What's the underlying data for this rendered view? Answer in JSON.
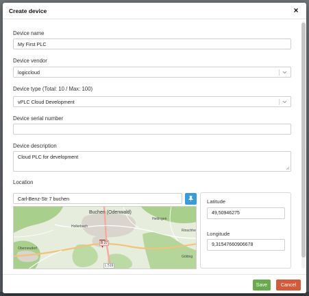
{
  "modal": {
    "title": "Create device",
    "close_glyph": "×"
  },
  "fields": {
    "device_name": {
      "label": "Device name",
      "value": "My First PLC"
    },
    "device_vendor": {
      "label": "Device vendor",
      "value": "logiccloud"
    },
    "device_type": {
      "label": "Device type (Total: 10 / Max: 100)",
      "value": "vPLC Cloud Development"
    },
    "serial_number": {
      "label": "Device serial number",
      "value": ""
    },
    "description": {
      "label": "Device description",
      "value": "Cloud PLC for development"
    }
  },
  "location": {
    "label": "Location",
    "address": "Carl-Benz-Str 7 buchen",
    "pin_icon": "pin-icon",
    "latitude_label": "Latitude",
    "latitude": "49,50946275",
    "longitude_label": "Longitude",
    "longitude": "9,31547660906678"
  },
  "map": {
    "town": "Buchen (Odenwald)",
    "places": {
      "hollerbach": "Hollerbach",
      "hettingen": "Hettingen",
      "rinschheim": "Rinschhe",
      "oberneudorf": "Oberneudorf",
      "gottingen": "Götting"
    },
    "road_b27": "B 27",
    "road_l519": "L 519",
    "marker_icon": "map-marker-icon"
  },
  "footer": {
    "save_label": "Save",
    "cancel_label": "Cancel"
  },
  "colors": {
    "save": "#6aaa4e",
    "cancel": "#d15b3a",
    "pin_button": "#3b9ad9",
    "marker": "#b01e1e"
  }
}
